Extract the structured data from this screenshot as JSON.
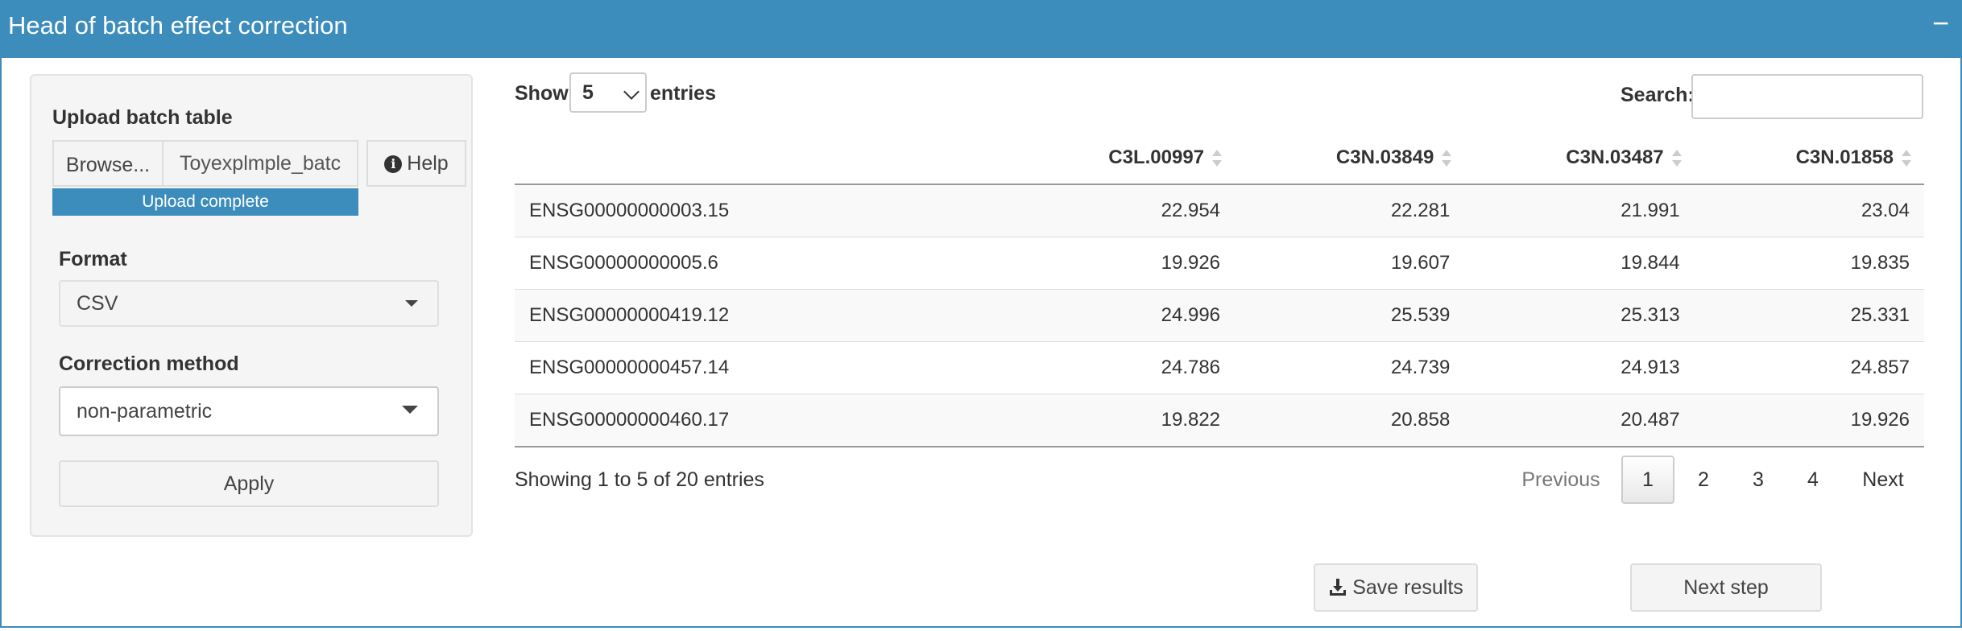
{
  "box": {
    "title": "Head of batch effect correction",
    "collapse": "−"
  },
  "sidebar": {
    "upload_label": "Upload batch table",
    "browse_label": "Browse...",
    "file_name": "Toyexplmple_batc",
    "help_label": "Help",
    "progress_text": "Upload complete",
    "format_label": "Format",
    "format_value": "CSV",
    "method_label": "Correction method",
    "method_value": "non-parametric",
    "apply_label": "Apply"
  },
  "table_controls": {
    "show_label": "Show",
    "entries_label": "entries",
    "page_length": "5",
    "search_label": "Search:",
    "search_value": ""
  },
  "table": {
    "columns": [
      "",
      "C3L.00997",
      "C3N.03849",
      "C3N.03487",
      "C3N.01858"
    ],
    "rows": [
      [
        "ENSG00000000003.15",
        "22.954",
        "22.281",
        "21.991",
        "23.04"
      ],
      [
        "ENSG00000000005.6",
        "19.926",
        "19.607",
        "19.844",
        "19.835"
      ],
      [
        "ENSG00000000419.12",
        "24.996",
        "25.539",
        "25.313",
        "25.331"
      ],
      [
        "ENSG00000000457.14",
        "24.786",
        "24.739",
        "24.913",
        "24.857"
      ],
      [
        "ENSG00000000460.17",
        "19.822",
        "20.858",
        "20.487",
        "19.926"
      ]
    ]
  },
  "pagination": {
    "info": "Showing 1 to 5 of 20 entries",
    "previous": "Previous",
    "pages": [
      "1",
      "2",
      "3",
      "4"
    ],
    "current": "1",
    "next": "Next"
  },
  "actions": {
    "save_label": "Save results",
    "next_label": "Next step"
  },
  "colors": {
    "header": "#3c8dbc",
    "progress": "#3c8dbc"
  }
}
